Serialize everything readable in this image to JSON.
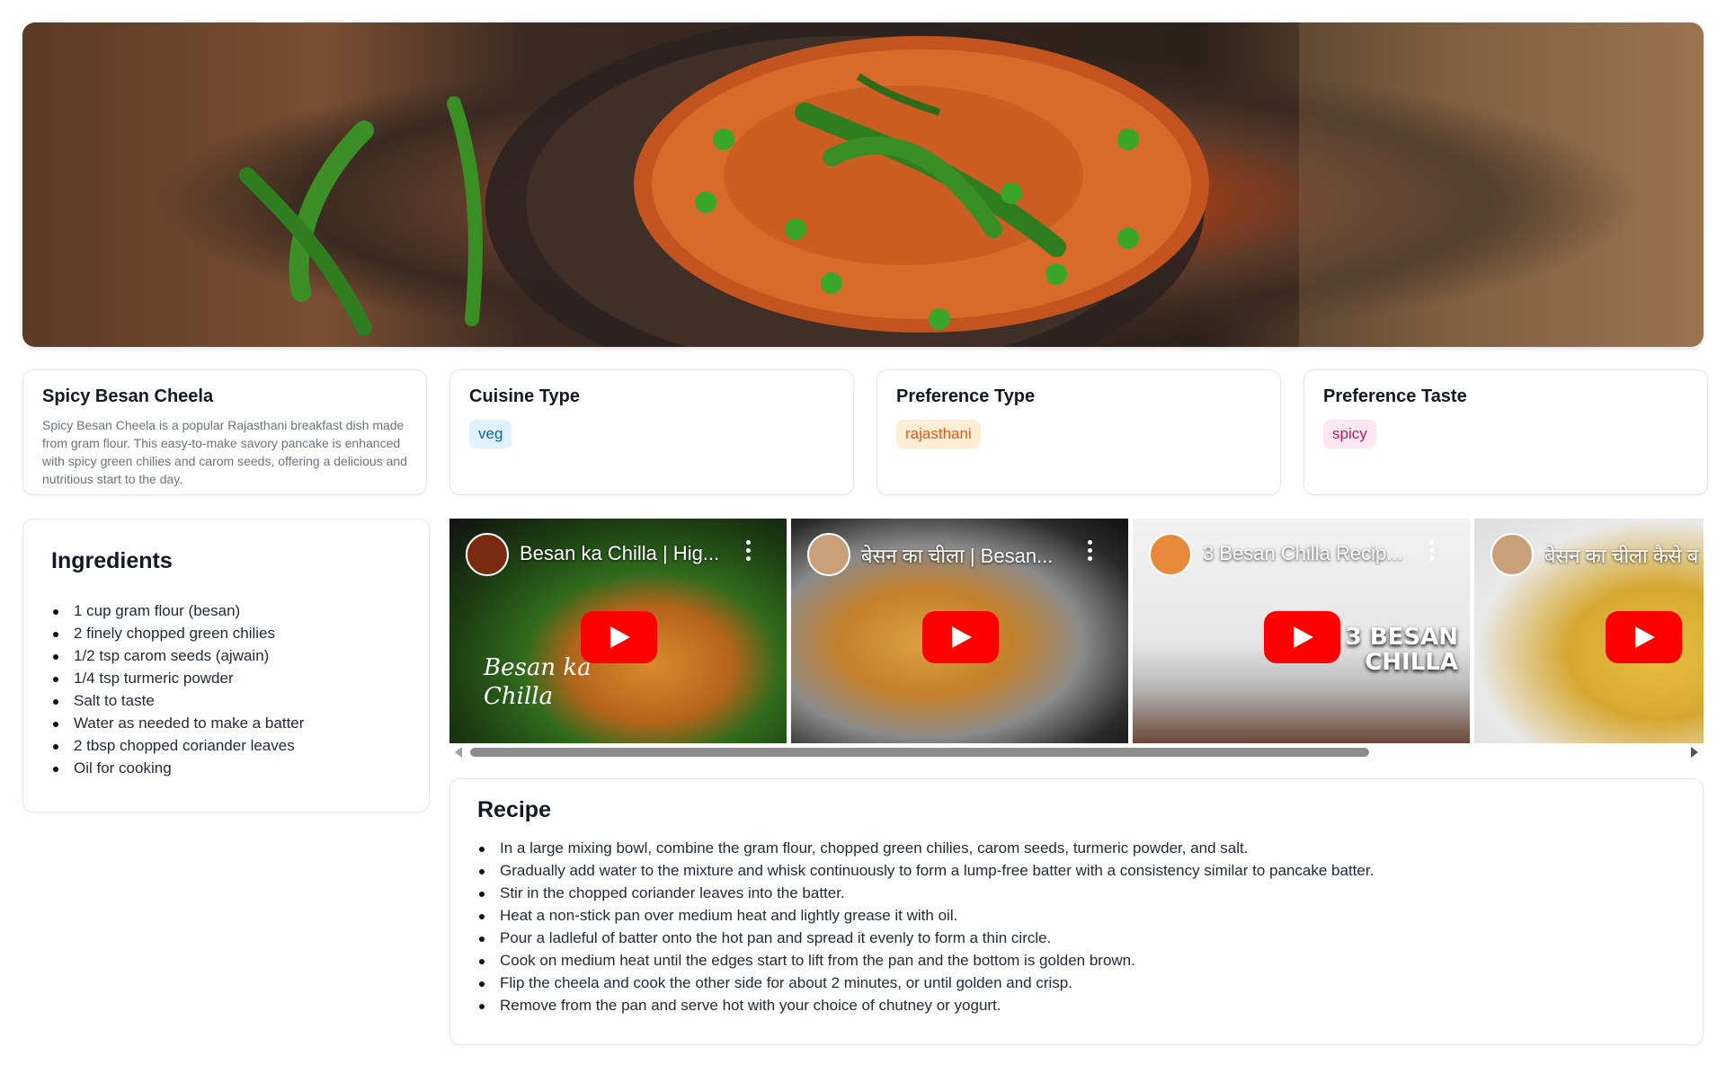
{
  "hero": {
    "image": "spicy-besan-cheela-photo"
  },
  "dish": {
    "title": "Spicy Besan Cheela",
    "description": "Spicy Besan Cheela is a popular Rajasthani breakfast dish made from gram flour. This easy-to-make savory pancake is enhanced with spicy green chilies and carom seeds, offering a delicious and nutritious start to the day."
  },
  "cuisine": {
    "label": "Cuisine Type",
    "value": "veg"
  },
  "preference_type": {
    "label": "Preference Type",
    "value": "rajasthani"
  },
  "preference_taste": {
    "label": "Preference Taste",
    "value": "spicy"
  },
  "ingredients": {
    "title": "Ingredients",
    "items": [
      "1 cup gram flour (besan)",
      "2 finely chopped green chilies",
      "1/2 tsp carom seeds (ajwain)",
      "1/4 tsp turmeric powder",
      "Salt to taste",
      "Water as needed to make a batter",
      "2 tbsp chopped coriander leaves",
      "Oil for cooking"
    ]
  },
  "videos": [
    {
      "title": "Besan ka Chilla | Hig...",
      "overlay": "Besan ka Chilla"
    },
    {
      "title": "बेसन का चीला | Besan..."
    },
    {
      "title": "3 Besan Chilla Recip...",
      "overlay": "3 BESAN CHILLA"
    },
    {
      "title": "बेसन का चीला कैसे ब"
    }
  ],
  "recipe": {
    "title": "Recipe",
    "steps": [
      "In a large mixing bowl, combine the gram flour, chopped green chilies, carom seeds, turmeric powder, and salt.",
      "Gradually add water to the mixture and whisk continuously to form a lump-free batter with a consistency similar to pancake batter.",
      "Stir in the chopped coriander leaves into the batter.",
      "Heat a non-stick pan over medium heat and lightly grease it with oil.",
      "Pour a ladleful of batter onto the hot pan and spread it evenly to form a thin circle.",
      "Cook on medium heat until the edges start to lift from the pan and the bottom is golden brown.",
      "Flip the cheela and cook the other side for about 2 minutes, or until golden and crisp.",
      "Remove from the pan and serve hot with your choice of chutney or yogurt."
    ]
  }
}
